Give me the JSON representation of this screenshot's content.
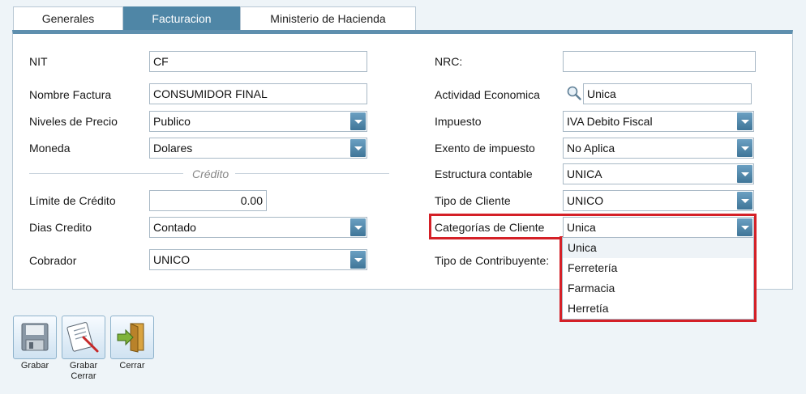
{
  "tabs": [
    {
      "label": "Generales"
    },
    {
      "label": "Facturacion"
    },
    {
      "label": "Ministerio de Hacienda"
    }
  ],
  "left": {
    "nit": {
      "label": "NIT",
      "value": "CF"
    },
    "nombre_factura": {
      "label": "Nombre Factura",
      "value": "CONSUMIDOR FINAL"
    },
    "niveles_precio": {
      "label": "Niveles de Precio",
      "value": "Publico"
    },
    "moneda": {
      "label": "Moneda",
      "value": "Dolares"
    },
    "credito_section": "Crédito",
    "limite_credito": {
      "label": "Límite de Crédito",
      "value": "0.00"
    },
    "dias_credito": {
      "label": "Dias Credito",
      "value": "Contado"
    },
    "cobrador": {
      "label": "Cobrador",
      "value": "UNICO"
    }
  },
  "right": {
    "nrc": {
      "label": "NRC:",
      "value": ""
    },
    "actividad": {
      "label": "Actividad Economica",
      "value": "Unica"
    },
    "impuesto": {
      "label": "Impuesto",
      "value": "IVA Debito Fiscal"
    },
    "exento": {
      "label": "Exento de impuesto",
      "value": "No Aplica"
    },
    "estructura": {
      "label": "Estructura contable",
      "value": "UNICA"
    },
    "tipo_cliente": {
      "label": "Tipo de Cliente",
      "value": "UNICO"
    },
    "categorias": {
      "label": "Categorías de Cliente",
      "value": "Unica"
    },
    "tipo_contribuyente": {
      "label": "Tipo de Contribuyente:"
    }
  },
  "categorias_options": [
    "Unica",
    "Ferretería",
    "Farmacia",
    "Herretía"
  ],
  "toolbar": {
    "grabar": "Grabar",
    "grabar_cerrar_1": "Grabar",
    "grabar_cerrar_2": "Cerrar",
    "cerrar": "Cerrar"
  },
  "colors": {
    "accent": "#4f86a6",
    "highlight": "#d42027"
  }
}
